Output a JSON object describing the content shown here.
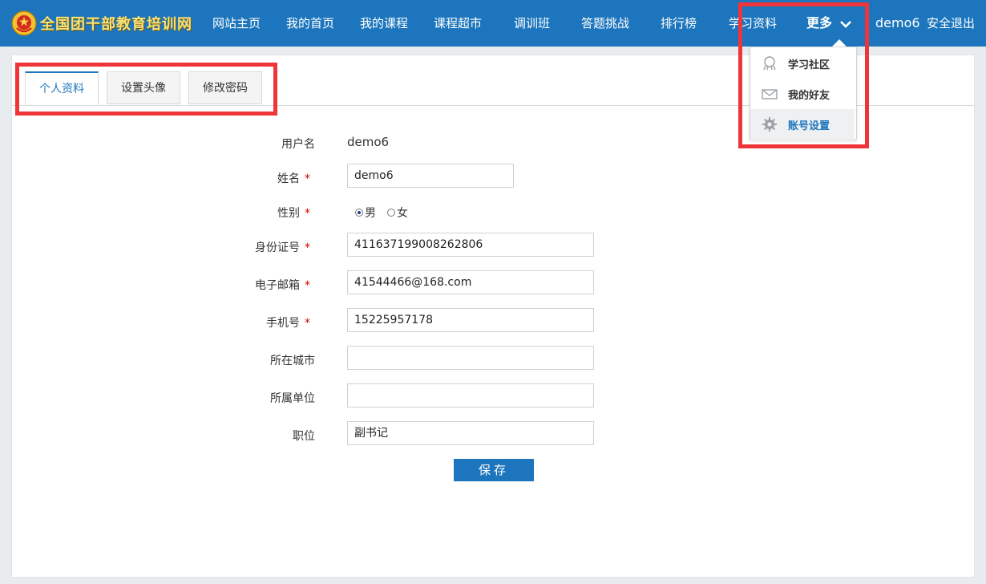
{
  "brand": {
    "title": "全国团干部教育培训网",
    "emblem_icon": "youth-league-emblem-icon"
  },
  "nav": {
    "items": [
      "网站主页",
      "我的首页",
      "我的课程",
      "课程超市",
      "调训班",
      "答题挑战",
      "排行榜",
      "学习资料"
    ],
    "more_label": "更多",
    "user": "demo6",
    "logout": "安全退出"
  },
  "dropdown": {
    "items": [
      {
        "label": "学习社区",
        "icon": "community-icon"
      },
      {
        "label": "我的好友",
        "icon": "envelope-icon"
      },
      {
        "label": "账号设置",
        "icon": "gear-icon"
      }
    ]
  },
  "tabs": [
    "个人资料",
    "设置头像",
    "修改密码"
  ],
  "form": {
    "username_label": "用户名",
    "username_value": "demo6",
    "name_label": "姓名",
    "name_value": "demo6",
    "gender_label": "性别",
    "gender_male": "男",
    "gender_female": "女",
    "id_label": "身份证号",
    "id_value": "411637199008262806",
    "email_label": "电子邮箱",
    "email_value": "41544466@168.com",
    "phone_label": "手机号",
    "phone_value": "15225957178",
    "city_label": "所在城市",
    "city_value": "",
    "org_label": "所属单位",
    "org_value": "",
    "position_label": "职位",
    "position_value": "副书记",
    "required_mark": "*",
    "save_label": "保存"
  },
  "colors": {
    "nav_bg": "#1d76bd",
    "accent": "#1d76bd",
    "highlight": "#f0353a",
    "required": "#cc0000"
  }
}
